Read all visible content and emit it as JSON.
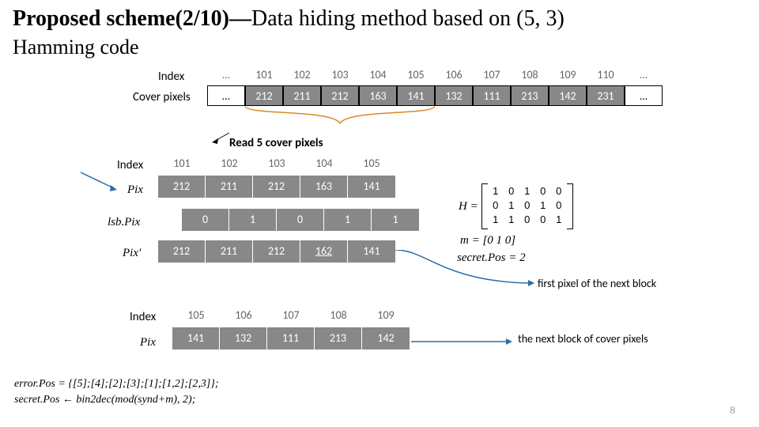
{
  "title": {
    "bold": "Proposed scheme(2/10)—",
    "rest": "Data hiding method based on (5, 3)"
  },
  "subtitle": "Hamming code",
  "labels": {
    "index1": "Index",
    "cover": "Cover pixels",
    "read5": "Read 5 cover pixels",
    "index2": "Index",
    "pix": "Pix",
    "lsb": "lsb.Pix",
    "pixp": "Pix'",
    "index3": "Index",
    "pix2": "Pix",
    "firstpx": "first pixel of the next block",
    "nextblk": "the next block of cover pixels",
    "Heq": "H =",
    "meq": "m = [0 1 0]",
    "secpos": "secret.Pos  =  2",
    "errpos": "error.Pos = {[5];[4];[2];[3];[1];[1,2];[2,3]};",
    "secrule": "secret.Pos ← bin2dec(mod(synd+m), 2);"
  },
  "top": {
    "idx": [
      "…",
      "101",
      "102",
      "103",
      "104",
      "105",
      "106",
      "107",
      "108",
      "109",
      "110",
      "…"
    ],
    "vals": [
      "…",
      "212",
      "211",
      "212",
      "163",
      "141",
      "132",
      "111",
      "213",
      "142",
      "231",
      "…"
    ]
  },
  "block1": {
    "idx": [
      "101",
      "102",
      "103",
      "104",
      "105"
    ],
    "pix": [
      "212",
      "211",
      "212",
      "163",
      "141"
    ],
    "lsb": [
      "0",
      "1",
      "0",
      "1",
      "1"
    ],
    "pixp": [
      "212",
      "211",
      "212",
      "162",
      "141"
    ]
  },
  "block2": {
    "idx": [
      "105",
      "106",
      "107",
      "108",
      "109"
    ],
    "pix": [
      "141",
      "132",
      "111",
      "213",
      "142"
    ]
  },
  "H": [
    [
      "1",
      "0",
      "1",
      "0",
      "0"
    ],
    [
      "0",
      "1",
      "0",
      "1",
      "0"
    ],
    [
      "1",
      "1",
      "0",
      "0",
      "1"
    ]
  ],
  "page": "8",
  "chart_data": {
    "type": "table",
    "cover_pixels_index": [
      101,
      102,
      103,
      104,
      105,
      106,
      107,
      108,
      109,
      110
    ],
    "cover_pixels_values": [
      212,
      211,
      212,
      163,
      141,
      132,
      111,
      213,
      142,
      231
    ],
    "block1": {
      "index": [
        101,
        102,
        103,
        104,
        105
      ],
      "Pix": [
        212,
        211,
        212,
        163,
        141
      ],
      "lsbPix": [
        0,
        1,
        0,
        1,
        1
      ],
      "PixPrime": [
        212,
        211,
        212,
        162,
        141
      ]
    },
    "block2": {
      "index": [
        105,
        106,
        107,
        108,
        109
      ],
      "Pix": [
        141,
        132,
        111,
        213,
        142
      ]
    },
    "H_matrix": [
      [
        1,
        0,
        1,
        0,
        0
      ],
      [
        0,
        1,
        0,
        1,
        0
      ],
      [
        1,
        1,
        0,
        0,
        1
      ]
    ],
    "m": [
      0,
      1,
      0
    ],
    "secretPos": 2,
    "errorPos_sets": [
      [
        5
      ],
      [
        4
      ],
      [
        2
      ],
      [
        3
      ],
      [
        1
      ],
      [
        1,
        2
      ],
      [
        2,
        3
      ]
    ]
  }
}
